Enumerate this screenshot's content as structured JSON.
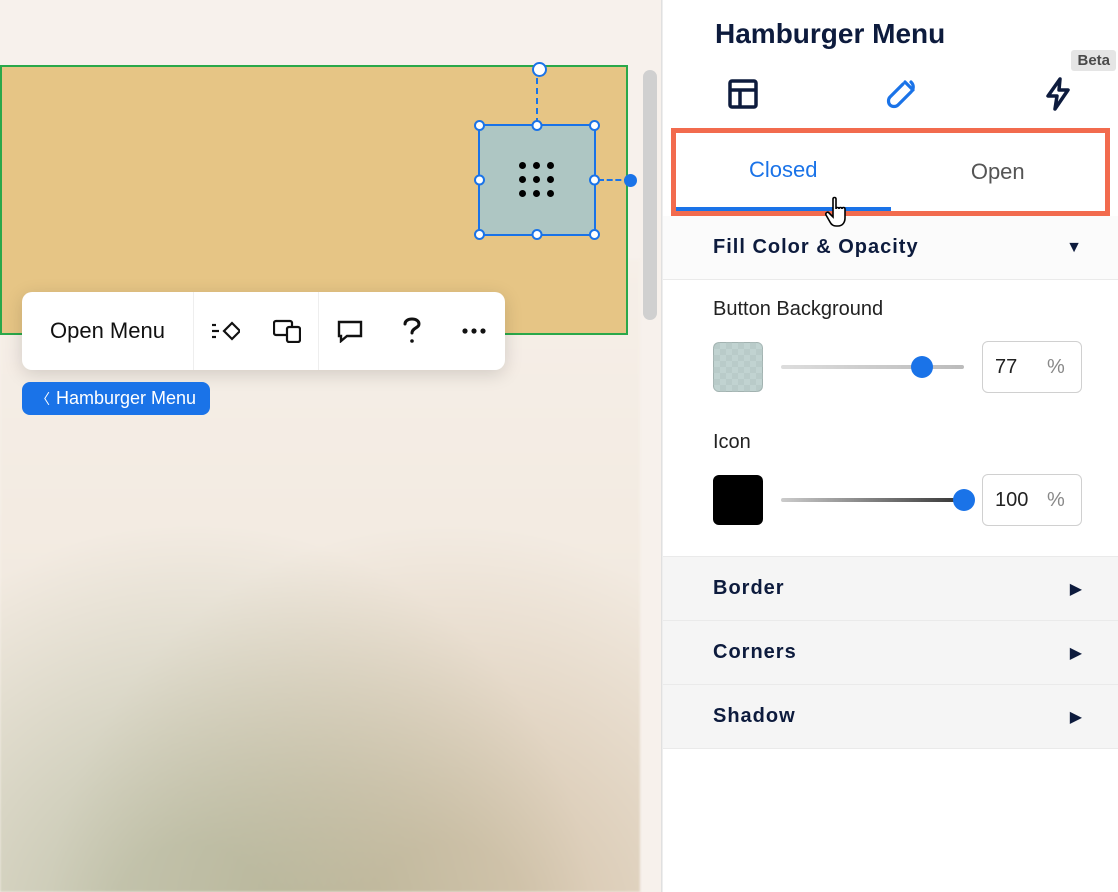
{
  "canvas": {
    "toolbar": {
      "open_menu_label": "Open Menu"
    },
    "breadcrumb_label": "Hamburger Menu"
  },
  "panel": {
    "title": "Hamburger Menu",
    "beta_label": "Beta",
    "state_tabs": {
      "closed": "Closed",
      "open": "Open",
      "active": "closed"
    },
    "sections": {
      "fill": {
        "label": "Fill Color & Opacity",
        "expanded": true,
        "button_background": {
          "label": "Button Background",
          "value": 77,
          "swatch_color": "#aec6c3",
          "swatch_alpha": 0.77
        },
        "icon": {
          "label": "Icon",
          "value": 100,
          "swatch_color": "#000000"
        }
      },
      "border": {
        "label": "Border",
        "expanded": false
      },
      "corners": {
        "label": "Corners",
        "expanded": false
      },
      "shadow": {
        "label": "Shadow",
        "expanded": false
      }
    },
    "unit_label": "%",
    "colors": {
      "accent": "#1a73e8",
      "highlight_border": "#f26b4e",
      "canvas_frame": "#e6c585",
      "selection_fill": "#aec6c3"
    }
  }
}
